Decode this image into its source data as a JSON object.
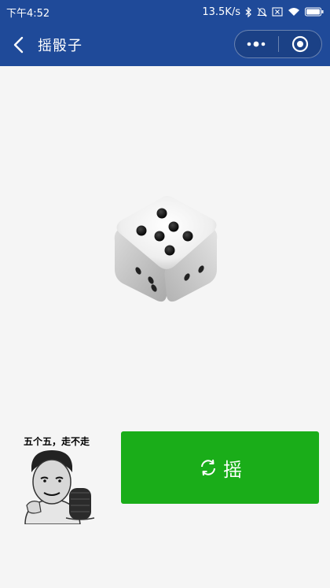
{
  "status_bar": {
    "time": "下午4:52",
    "network_speed": "13.5K/s",
    "icons": [
      "bluetooth-icon",
      "mute-icon",
      "x-box-icon",
      "wifi-icon",
      "battery-icon"
    ]
  },
  "nav": {
    "title": "摇骰子",
    "back_icon": "chevron-left-icon",
    "more_icon": "more-dots-icon",
    "close_icon": "target-circle-icon",
    "bar_color": "#1f4a99"
  },
  "dice": {
    "face_value": 6
  },
  "meme": {
    "caption": "五个五，走不走"
  },
  "shake_button": {
    "label": "摇",
    "icon": "refresh-icon",
    "color": "#1aad19"
  }
}
